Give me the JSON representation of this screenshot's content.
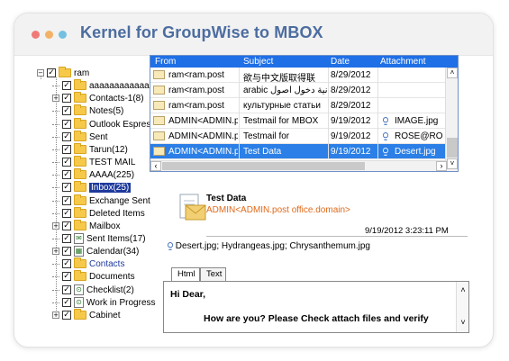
{
  "window": {
    "title": "Kernel for GroupWise to MBOX",
    "dots": [
      "#f07a77",
      "#f3b266",
      "#74c0e0"
    ]
  },
  "tree": {
    "root": "ram",
    "items": [
      {
        "label": "aaaaaaaaaaaaa",
        "expander": false,
        "kind": "folder"
      },
      {
        "label": "Contacts-1(8)",
        "expander": true,
        "kind": "folder"
      },
      {
        "label": "Notes(5)",
        "expander": false,
        "kind": "folder"
      },
      {
        "label": "Outlook Espress",
        "expander": false,
        "kind": "folder"
      },
      {
        "label": "Sent",
        "expander": false,
        "kind": "folder"
      },
      {
        "label": "Tarun(12)",
        "expander": false,
        "kind": "folder"
      },
      {
        "label": "TEST MAIL",
        "expander": false,
        "kind": "folder"
      },
      {
        "label": "AAAA(225)",
        "expander": false,
        "kind": "folder"
      },
      {
        "label": "Inbox(25)",
        "expander": false,
        "kind": "folder",
        "selected": true
      },
      {
        "label": "Exchange Sent",
        "expander": false,
        "kind": "folder"
      },
      {
        "label": "Deleted Items",
        "expander": false,
        "kind": "folder"
      },
      {
        "label": "Mailbox",
        "expander": true,
        "kind": "folder"
      },
      {
        "label": "Sent Items(17)",
        "expander": false,
        "kind": "sent"
      },
      {
        "label": "Calendar(34)",
        "expander": true,
        "kind": "calendar"
      },
      {
        "label": "Contacts",
        "expander": false,
        "kind": "folder",
        "blue": true
      },
      {
        "label": "Documents",
        "expander": false,
        "kind": "folder"
      },
      {
        "label": "Checklist(2)",
        "expander": false,
        "kind": "check"
      },
      {
        "label": "Work in Progress",
        "expander": false,
        "kind": "check"
      },
      {
        "label": "Cabinet",
        "expander": true,
        "kind": "folder"
      }
    ]
  },
  "grid": {
    "columns": [
      "From",
      "Subject",
      "Date",
      "Attachment"
    ],
    "rows": [
      {
        "from": "ram<ram.post",
        "subject": "欲与中文版取得联",
        "date": "8/29/2012",
        "attachment": "",
        "clip": false
      },
      {
        "from": "ram<ram.post",
        "subject": "arabic كانية دخول أصول",
        "date": "8/29/2012",
        "attachment": "",
        "clip": false
      },
      {
        "from": "ram<ram.post",
        "subject": "культурные статьи",
        "date": "8/29/2012",
        "attachment": "",
        "clip": false
      },
      {
        "from": "ADMIN<ADMIN.p",
        "subject": "Testmail for MBOX",
        "date": "9/19/2012",
        "attachment": "IMAGE.jpg",
        "clip": true
      },
      {
        "from": "ADMIN<ADMIN.p",
        "subject": "Testmail for",
        "date": "9/19/2012",
        "attachment": "ROSE@RO",
        "clip": true
      },
      {
        "from": "ADMIN<ADMIN.p",
        "subject": "Test Data",
        "date": "9/19/2012",
        "attachment": "Desert.jpg",
        "clip": true,
        "active": true
      }
    ]
  },
  "preview": {
    "subject": "Test Data",
    "from": "ADMIN<ADMIN.post office.domain>",
    "date": "9/19/2012 3:23:11 PM",
    "attachments": "Desert.jpg; Hydrangeas.jpg; Chrysanthemum.jpg",
    "tabs": [
      "Html",
      "Text"
    ],
    "body_line1": "Hi Dear,",
    "body_line2": "How are you? Please Check attach files and verify"
  },
  "icons": {
    "expander_plus": "+",
    "expander_minus": "−",
    "check": "✓",
    "clip": "⍜",
    "scroll_up": "˄",
    "scroll_down": "˅",
    "scroll_right": "›",
    "scroll_left": "‹"
  }
}
